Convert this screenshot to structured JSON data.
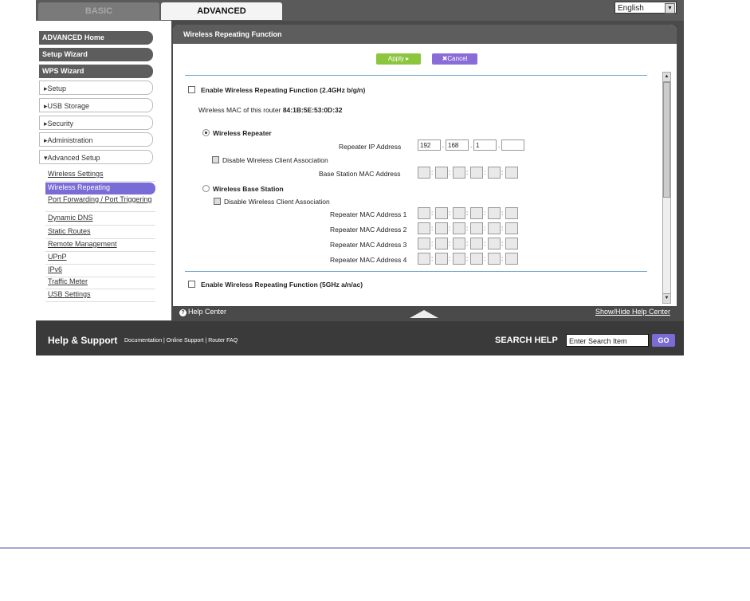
{
  "tabs": {
    "basic": "BASIC",
    "advanced": "ADVANCED"
  },
  "language": {
    "selected": "English"
  },
  "sidebar": {
    "main_items": [
      "ADVANCED Home",
      "Setup Wizard",
      "WPS Wizard"
    ],
    "sections": [
      "▸Setup",
      "▸USB Storage",
      "▸Security",
      "▸Administration",
      "▾Advanced Setup"
    ],
    "sub_items": [
      "Wireless Settings",
      "Wireless Repeating",
      "Port Forwarding / Port Triggering",
      "Dynamic DNS",
      "Static Routes",
      "Remote Management",
      "UPnP",
      "IPv6",
      "Traffic Meter",
      "USB Settings"
    ],
    "active_sub": "Wireless Repeating"
  },
  "panel": {
    "title": "Wireless Repeating Function",
    "apply_label": "Apply ▸",
    "cancel_label": "✖Cancel",
    "enable_24": "Enable Wireless Repeating Function (2.4GHz b/g/n)",
    "mac_label": "Wireless MAC of this router",
    "mac_value": "84:1B:5E:53:0D:32",
    "repeater_label": "Wireless Repeater",
    "repeater_ip_label": "Repeater IP Address",
    "repeater_ip": [
      "192",
      "168",
      "1",
      ""
    ],
    "disable_assoc_1": "Disable Wireless Client Association",
    "base_mac_label": "Base Station MAC Address",
    "base_station_label": "Wireless Base Station",
    "disable_assoc_2": "Disable Wireless Client Association",
    "repeater_macs": [
      "Repeater MAC Address 1",
      "Repeater MAC Address 2",
      "Repeater MAC Address 3",
      "Repeater MAC Address 4"
    ],
    "enable_5": "Enable Wireless Repeating Function (5GHz a/n/ac)"
  },
  "help_bar": {
    "help_center": "Help Center",
    "show_hide": "Show/Hide Help Center"
  },
  "support": {
    "title": "Help & Support",
    "links": "Documentation | Online Support | Router FAQ",
    "search_label": "SEARCH HELP",
    "search_value": "Enter Search Item",
    "go": "GO"
  },
  "colors": {
    "accent": "#7a6cd6",
    "apply": "#8cc63f",
    "chrome": "#4a4a4a"
  }
}
